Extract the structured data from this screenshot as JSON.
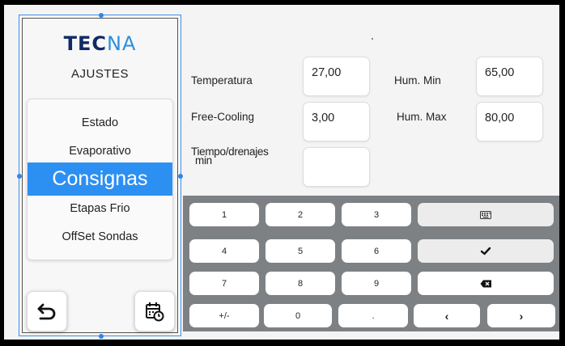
{
  "brand": {
    "part1": "TEC",
    "part2": "NA"
  },
  "sidebar": {
    "title": "AJUSTES",
    "items": [
      {
        "label": "Estado"
      },
      {
        "label": "Evaporativo"
      },
      {
        "label": "Consignas"
      },
      {
        "label": "Etapas Frio"
      },
      {
        "label": "OffSet Sondas"
      }
    ],
    "back_icon": "back-arrow-icon",
    "calendar_icon": "calendar-clock-icon"
  },
  "form": {
    "temperatura": {
      "label": "Temperatura",
      "value": "27,00"
    },
    "free_cooling": {
      "label": "Free-Cooling",
      "value": "3,00"
    },
    "tiempo": {
      "label_line1": "Tiempo/drenajes",
      "label_line2": "min",
      "value": ""
    },
    "hum_min": {
      "label": "Hum. Min",
      "value": "65,00"
    },
    "hum_max": {
      "label": "Hum. Max",
      "value": "80,00"
    }
  },
  "keypad": {
    "row1": [
      "1",
      "2",
      "3"
    ],
    "row2": [
      "4",
      "5",
      "6"
    ],
    "row3": [
      "7",
      "8",
      "9"
    ],
    "row4": [
      "+/-",
      "0",
      ".",
      "‹",
      "›"
    ],
    "keyboard_icon": "keyboard-icon",
    "check_icon": "check-icon",
    "backspace_icon": "backspace-icon"
  },
  "colors": {
    "accent": "#2c8ff2",
    "keypad_bg": "#7d8184",
    "brand_dark": "#0f2a66"
  }
}
